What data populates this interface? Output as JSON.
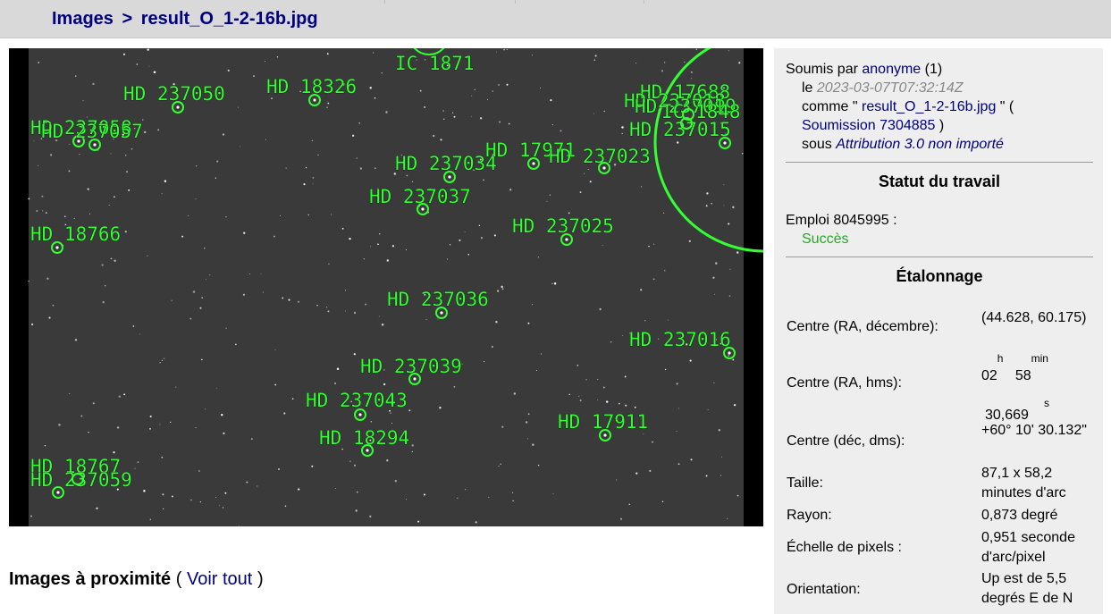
{
  "breadcrumb": {
    "parent": "Images",
    "separator": ">",
    "current": "result_O_1-2-16b.jpg"
  },
  "colors": {
    "annotation": "#33ff33",
    "link": "#000080",
    "success": "#22aa22",
    "sky": "#3a3a3a"
  },
  "plot": {
    "annotations": [
      {
        "label": "IC 1871"
      },
      {
        "label": "HD 237050"
      },
      {
        "label": "HD 18326"
      },
      {
        "label": "HD 237058"
      },
      {
        "label": "HD 237057"
      },
      {
        "label": "HD 17688"
      },
      {
        "label": "HD 237018"
      },
      {
        "label": "HD 237019"
      },
      {
        "label": "IC 1848"
      },
      {
        "label": "HD 237015"
      },
      {
        "label": "HD 17971"
      },
      {
        "label": "HD 237023"
      },
      {
        "label": "HD 237034"
      },
      {
        "label": "HD 237037"
      },
      {
        "label": "HD 18766"
      },
      {
        "label": "HD 237025"
      },
      {
        "label": "HD 237036"
      },
      {
        "label": "HD 237016"
      },
      {
        "label": "HD 237039"
      },
      {
        "label": "HD 237043"
      },
      {
        "label": "HD 17911"
      },
      {
        "label": "HD 18294"
      },
      {
        "label": "HD 18767"
      },
      {
        "label": "HD 237059"
      }
    ]
  },
  "nearby": {
    "title": "Images à proximité",
    "open": "(",
    "link": "Voir tout",
    "close": ")"
  },
  "submission": {
    "by_label": "Soumis par",
    "user": "anonyme",
    "count": "(1)",
    "on_label": "le",
    "date": "2023-03-07T07:32:14Z",
    "as_label": "comme \"",
    "filename": "result_O_1-2-16b.jpg",
    "as_close": "\" (",
    "submission_link": "Soumission 7304885",
    "paren_close": ")",
    "under_label": "sous",
    "license": "Attribution 3.0 non importé"
  },
  "job": {
    "title": "Statut du travail",
    "label": "Emploi 8045995 :",
    "status": "Succès"
  },
  "calibration": {
    "title": "Étalonnage",
    "center_radec_label": "Centre (RA, décembre):",
    "center_radec_value": "(44.628, 60.175)",
    "center_hms_label": "Centre (RA, hms):",
    "hms_h": "02",
    "hms_h_unit": "h",
    "hms_m": "58",
    "hms_m_unit": "min",
    "hms_s_unit": "s",
    "hms_s": "30,669",
    "center_dms_label": "Centre (déc, dms):",
    "center_dms_value": "+60° 10' 30.132\"",
    "size_label": "Taille:",
    "size_value": "87,1 x 58,2 minutes d'arc",
    "radius_label": "Rayon:",
    "radius_value": "0,873 degré",
    "scale_label": "Échelle de pixels :",
    "scale_value": "0,951 seconde d'arc/pixel",
    "orientation_label": "Orientation:",
    "orientation_value": "Up est de 5,5 degrés E de N"
  }
}
